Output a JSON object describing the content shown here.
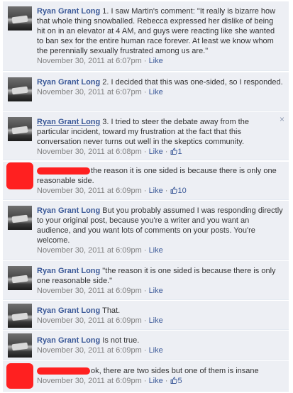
{
  "comments": [
    {
      "author": "Ryan Grant Long",
      "text": "1. I saw Martin's comment: \"It really is bizarre how that whole thing snowballed. Rebecca expressed her dislike of being hit on in an elevator at 4 AM, and guys were reacting like she wanted to ban sex for the entire human race forever. At least we know whom the perennially sexually frustrated among us are.\"",
      "timestamp": "November 30, 2011 at 6:07pm",
      "like_label": "Like"
    },
    {
      "author": "Ryan Grant Long",
      "text": "2. I decided that this was one-sided, so I responded.",
      "timestamp": "November 30, 2011 at 6:07pm",
      "like_label": "Like"
    },
    {
      "author": "Ryan Grant Long",
      "text": "3. I tried to steer the debate away from the particular incident, toward my frustration at the fact that this conversation never turns out well in the skeptics community.",
      "timestamp": "November 30, 2011 at 6:08pm",
      "like_label": "Like",
      "like_count": "1",
      "close_glyph": "×"
    },
    {
      "author": "",
      "text": "the reason it is one sided is because there is only one reasonable side.",
      "timestamp": "November 30, 2011 at 6:09pm",
      "like_label": "Like",
      "like_count": "10"
    },
    {
      "author": "Ryan Grant Long",
      "text": "But you probably assumed I was responding directly to your original post, because you're a writer and you want an audience, and you want lots of comments on your posts. You're welcome.",
      "timestamp": "November 30, 2011 at 6:09pm",
      "like_label": "Like"
    },
    {
      "author": "Ryan Grant Long",
      "text": "\"the reason it is one sided is because there is only one reasonable side.\"",
      "timestamp": "November 30, 2011 at 6:09pm",
      "like_label": "Like"
    },
    {
      "author": "Ryan Grant Long",
      "text": "That.",
      "timestamp": "November 30, 2011 at 6:09pm",
      "like_label": "Like"
    },
    {
      "author": "Ryan Grant Long",
      "text": "Is not true.",
      "timestamp": "November 30, 2011 at 6:09pm",
      "like_label": "Like"
    },
    {
      "author": "",
      "text": "ok, there are two sides but one of them is insane",
      "timestamp": "November 30, 2011 at 6:09pm",
      "like_label": "Like",
      "like_count": "5"
    }
  ],
  "separator": " · ",
  "icons": {
    "avatar": "profile-photo",
    "redaction": "red-redaction-mark",
    "like": "thumbs-up-icon",
    "close": "close-icon"
  },
  "colors": {
    "link": "#3b5998",
    "background": "#edeff4",
    "meta": "#808080",
    "redaction": "#ff2020"
  }
}
